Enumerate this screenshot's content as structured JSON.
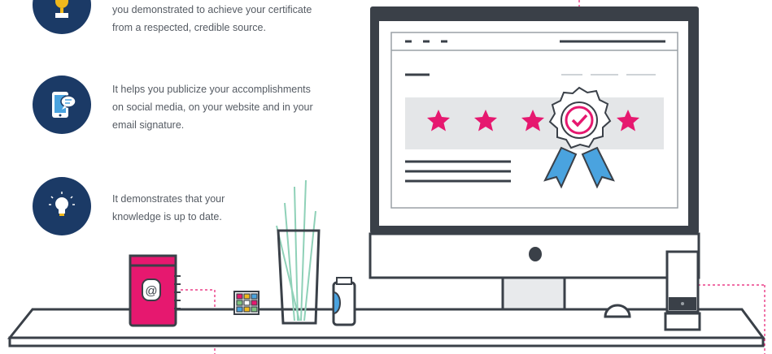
{
  "features": [
    {
      "icon": "trophy-icon",
      "lines": [
        "you demonstrated to achieve your certificate",
        "from a respected, credible source."
      ]
    },
    {
      "icon": "tablet-chat-icon",
      "lines": [
        "It helps you publicize your accomplishments",
        "on social media, on your website and in your",
        "email signature."
      ]
    },
    {
      "icon": "lightbulb-icon",
      "lines": [
        "It demonstrates that your",
        "knowledge is up to date."
      ]
    }
  ],
  "colors": {
    "badge": "#1b3a66",
    "accent_pink": "#e6186f",
    "accent_blue": "#4aa3df",
    "outline": "#3a4048",
    "text": "#555b63"
  },
  "illustration": {
    "certificate_stars": 4,
    "book_symbol": "@"
  }
}
